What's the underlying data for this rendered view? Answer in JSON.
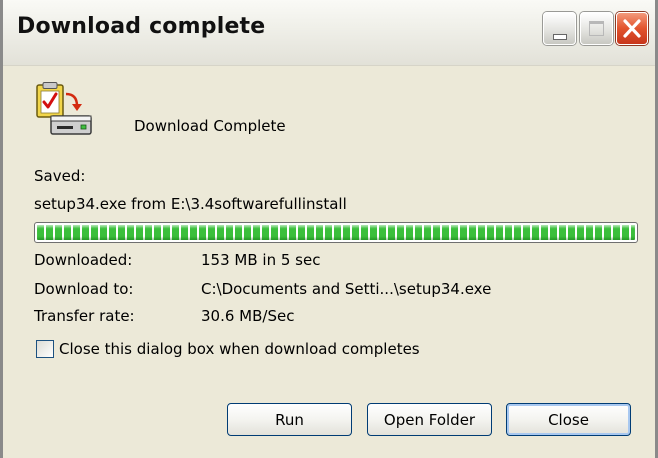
{
  "window": {
    "title": "Download complete"
  },
  "titlebar_buttons": {
    "minimize": "minimize-icon",
    "maximize": "maximize-icon",
    "close": "close-icon"
  },
  "dialog": {
    "heading": "Download Complete",
    "saved_label": "Saved:",
    "source": "setup34.exe from E:\\3.4softwarefullinstall",
    "progress_percent": 100,
    "details": [
      {
        "label": "Downloaded:",
        "value": "153 MB in 5 sec"
      },
      {
        "label": "Download to:",
        "value": "C:\\Documents and Setti...\\setup34.exe"
      },
      {
        "label": "Transfer rate:",
        "value": "30.6 MB/Sec"
      }
    ],
    "checkbox": {
      "label": "Close this dialog box when download completes",
      "checked": false
    },
    "buttons": {
      "run": "Run",
      "open_folder": "Open Folder",
      "close": "Close"
    }
  },
  "colors": {
    "dialog_bg": "#ece9d8",
    "progress_green": "#3bbf3b",
    "close_button_red": "#e2532d",
    "button_border": "#003c74"
  }
}
